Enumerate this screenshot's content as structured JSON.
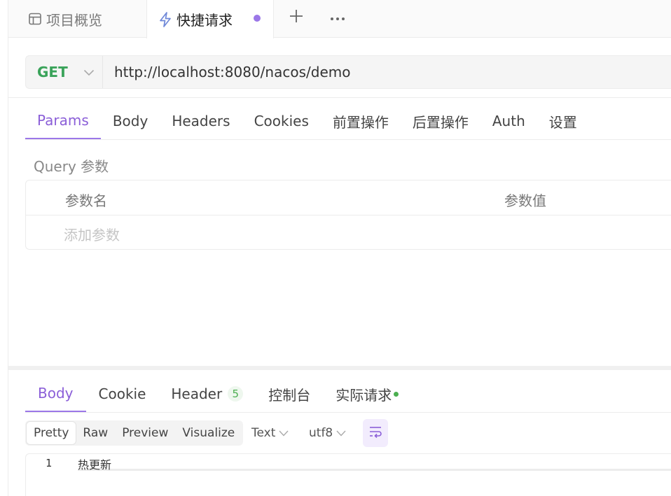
{
  "tabs": {
    "overview_label": "项目概览",
    "quick_label": "快捷请求"
  },
  "request": {
    "method": "GET",
    "url": "http://localhost:8080/nacos/demo",
    "tabs": [
      "Params",
      "Body",
      "Headers",
      "Cookies",
      "前置操作",
      "后置操作",
      "Auth",
      "设置"
    ],
    "active_tab": "Params"
  },
  "query": {
    "title": "Query 参数",
    "col_name": "参数名",
    "col_value": "参数值",
    "add_placeholder": "添加参数"
  },
  "response": {
    "tabs": {
      "body": "Body",
      "cookie": "Cookie",
      "header": "Header",
      "header_count": "5",
      "console": "控制台",
      "actual": "实际请求"
    },
    "views": [
      "Pretty",
      "Raw",
      "Preview",
      "Visualize"
    ],
    "active_view": "Pretty",
    "format": "Text",
    "encoding": "utf8",
    "lines": [
      {
        "num": "1",
        "text": "热更新"
      }
    ]
  },
  "colors": {
    "accent": "#9b77e8",
    "method_get": "#3aa35a",
    "status_dot": "#4caf50"
  },
  "icons": [
    "layout-icon",
    "lightning-icon",
    "plus-icon",
    "more-icon",
    "chevron-down-icon",
    "wrap-lines-icon"
  ]
}
